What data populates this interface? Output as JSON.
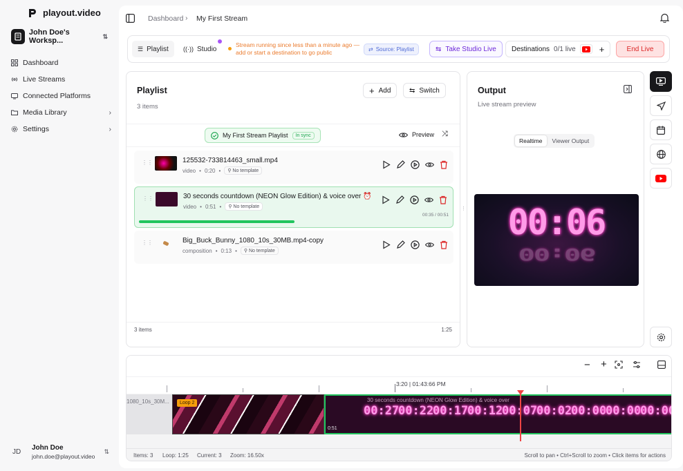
{
  "app": {
    "name": "playout.video"
  },
  "workspace": {
    "name": "John Doe's Worksp..."
  },
  "sidebar": {
    "items": [
      {
        "label": "Dashboard",
        "icon": "grid-icon"
      },
      {
        "label": "Live Streams",
        "icon": "broadcast-icon"
      },
      {
        "label": "Connected Platforms",
        "icon": "link-icon"
      },
      {
        "label": "Media Library",
        "icon": "folder-icon"
      },
      {
        "label": "Settings",
        "icon": "gear-icon"
      }
    ]
  },
  "user": {
    "initials": "JD",
    "name": "John Doe",
    "email": "john.doe@playout.video"
  },
  "breadcrumb": {
    "root": "Dashboard",
    "current": "My First Stream"
  },
  "toolbar": {
    "tab_playlist": "Playlist",
    "tab_studio": "Studio",
    "status_text": "Stream running since less than a minute ago — add or start a destination to go public",
    "source_label": "Source: Playlist",
    "take_studio_live": "Take Studio Live",
    "destinations_label": "Destinations",
    "destinations_count": "0/1 live",
    "end_live": "End Live"
  },
  "playlist": {
    "title": "Playlist",
    "count": "3 items",
    "add_label": "Add",
    "switch_label": "Switch",
    "sync_name": "My First Stream Playlist",
    "sync_badge": "In sync",
    "preview_label": "Preview",
    "footer_count": "3 items",
    "footer_duration": "1:25",
    "items": [
      {
        "name": "125532-733814463_small.mp4",
        "type": "video",
        "duration": "0:20",
        "template": "No template"
      },
      {
        "name": "30 seconds countdown (NEON Glow Edition) & voice over ⏰",
        "type": "video",
        "duration": "0:51",
        "template": "No template",
        "progress_text": "00:35 / 00:51",
        "progress": 0.69
      },
      {
        "name": "Big_Buck_Bunny_1080_10s_30MB.mp4-copy",
        "type": "composition",
        "duration": "0:13",
        "template": "No template"
      }
    ]
  },
  "output": {
    "title": "Output",
    "subtitle": "Live stream preview",
    "mode_realtime": "Realtime",
    "mode_viewer": "Viewer Output",
    "preview_time": "00:06"
  },
  "timeline": {
    "playhead_label": "3:20 | 01:43:66 PM",
    "clip1_label": "1080_10s_30M...",
    "loop_badge": "Loop 2",
    "clip3_time": "0:51",
    "clip3_title": "30 seconds countdown (NEON Glow Edition) & voice over",
    "frame_numbers": [
      "00:27",
      "00:22",
      "00:17",
      "00:12",
      "00:07",
      "00:02",
      "00:00",
      "00:00",
      "00:00"
    ],
    "stats": {
      "items": "Items: 3",
      "loop": "Loop: 1:25",
      "current": "Current: 3",
      "zoom": "Zoom: 16.50x"
    },
    "hint": "Scroll to pan • Ctrl+Scroll to zoom • Click items for actions"
  },
  "colors": {
    "accent_green": "#22c55e",
    "end_red": "#dc2626",
    "studio_purple": "#6d28d9",
    "youtube_red": "#ff0000",
    "status_orange": "#ea7a2c"
  }
}
